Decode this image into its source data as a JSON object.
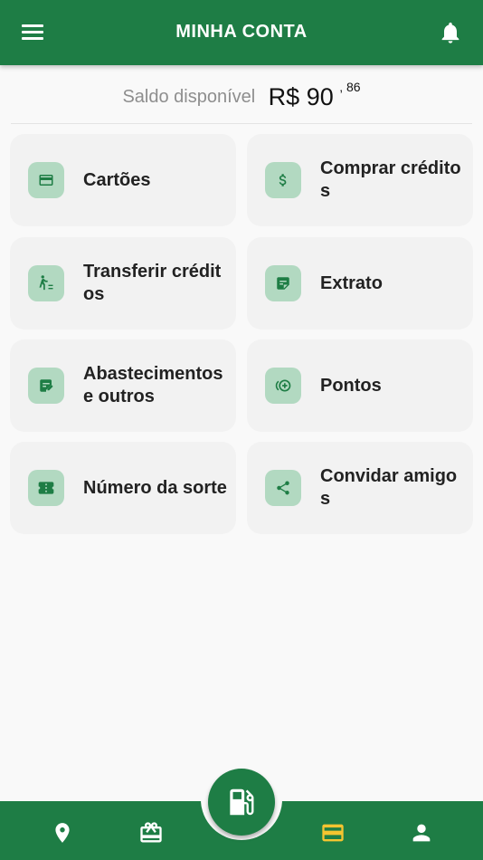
{
  "header": {
    "title": "MINHA CONTA",
    "menu_icon": "menu-icon",
    "notification_icon": "bell-icon"
  },
  "balance": {
    "label": "Saldo disponível",
    "amount": "R$ 90",
    "cents": ", 86"
  },
  "menu": [
    {
      "label": "Cartões",
      "icon": "credit-card-icon"
    },
    {
      "label": "Comprar créditos",
      "icon": "dollar-icon"
    },
    {
      "label": "Transferir créditos",
      "icon": "transfer-icon"
    },
    {
      "label": "Extrato",
      "icon": "statement-icon"
    },
    {
      "label": "Abastecimentos e outros",
      "icon": "note-edit-icon"
    },
    {
      "label": "Pontos",
      "icon": "coins-add-icon"
    },
    {
      "label": "Número da sorte",
      "icon": "ticket-icon"
    },
    {
      "label": "Convidar amigos",
      "icon": "share-icon"
    }
  ],
  "bottom_nav": {
    "items": [
      {
        "icon": "map-pin-icon",
        "active": false
      },
      {
        "icon": "gift-card-icon",
        "active": false
      },
      {
        "icon": "wallet-icon",
        "active": true
      },
      {
        "icon": "person-icon",
        "active": false
      }
    ],
    "fab_icon": "fuel-pump-icon"
  },
  "colors": {
    "primary": "#1e7d45",
    "icon_bg": "#b2d9c1",
    "active_nav": "#f4c430",
    "card_bg": "#f2f2f2"
  }
}
